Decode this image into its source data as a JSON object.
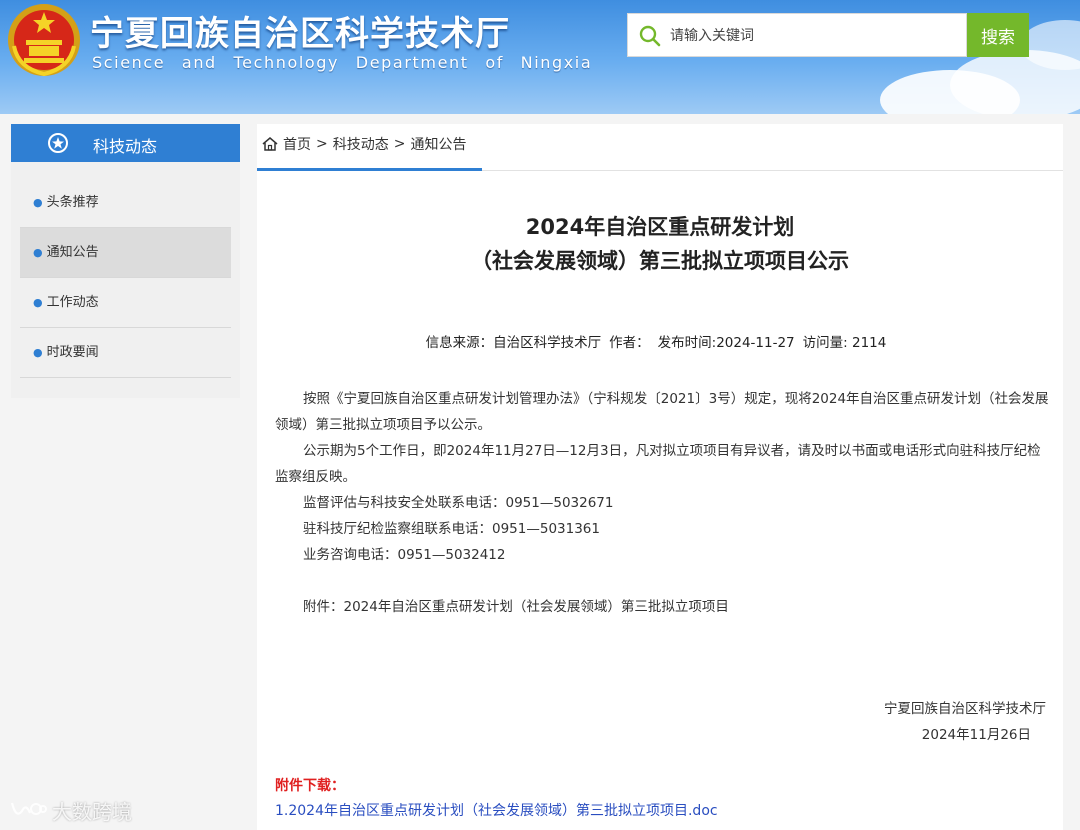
{
  "header": {
    "site_title": "宁夏回族自治区科学技术厅",
    "site_subtitle": "Science and Technology Department of Ningxia",
    "search_placeholder": "请输入关键词",
    "search_button": "搜索"
  },
  "sidebar": {
    "heading": "科技动态",
    "items": [
      {
        "label": "头条推荐",
        "active": false
      },
      {
        "label": "通知公告",
        "active": true
      },
      {
        "label": "工作动态",
        "active": false
      },
      {
        "label": "时政要闻",
        "active": false
      }
    ]
  },
  "breadcrumb": {
    "home": "首页",
    "level1": "科技动态",
    "level2": "通知公告",
    "separator": ">"
  },
  "article": {
    "title_line1": "2024年自治区重点研发计划",
    "title_line2": "（社会发展领域）第三批拟立项项目公示",
    "meta": {
      "source": "信息来源：自治区科学技术厅",
      "author": "作者：",
      "published": "发布时间:2024-11-27",
      "views": "访问量: 2114"
    },
    "paragraphs": [
      "按照《宁夏回族自治区重点研发计划管理办法》（宁科规发〔2021〕3号）规定，现将2024年自治区重点研发计划（社会发展领域）第三批拟立项项目予以公示。",
      "公示期为5个工作日，即2024年11月27日—12月3日，凡对拟立项项目有异议者，请及时以书面或电话形式向驻科技厅纪检监察组反映。",
      "监督评估与科技安全处联系电话：0951—5032671",
      "驻科技厅纪检监察组联系电话：0951—5031361",
      "业务咨询电话：0951—5032412",
      "",
      "附件：2024年自治区重点研发计划（社会发展领域）第三批拟立项项目"
    ],
    "signature_org": "宁夏回族自治区科学技术厅",
    "signature_date": "2024年11月26日",
    "attachment_label": "附件下载：",
    "attachment_link": "1.2024年自治区重点研发计划（社会发展领域）第三批拟立项项目.doc"
  },
  "watermark": "大数跨境",
  "colors": {
    "primary_blue": "#2f7fd3",
    "search_green": "#74b82b",
    "attachment_red": "#e02020",
    "link_blue": "#2a4ec0"
  }
}
